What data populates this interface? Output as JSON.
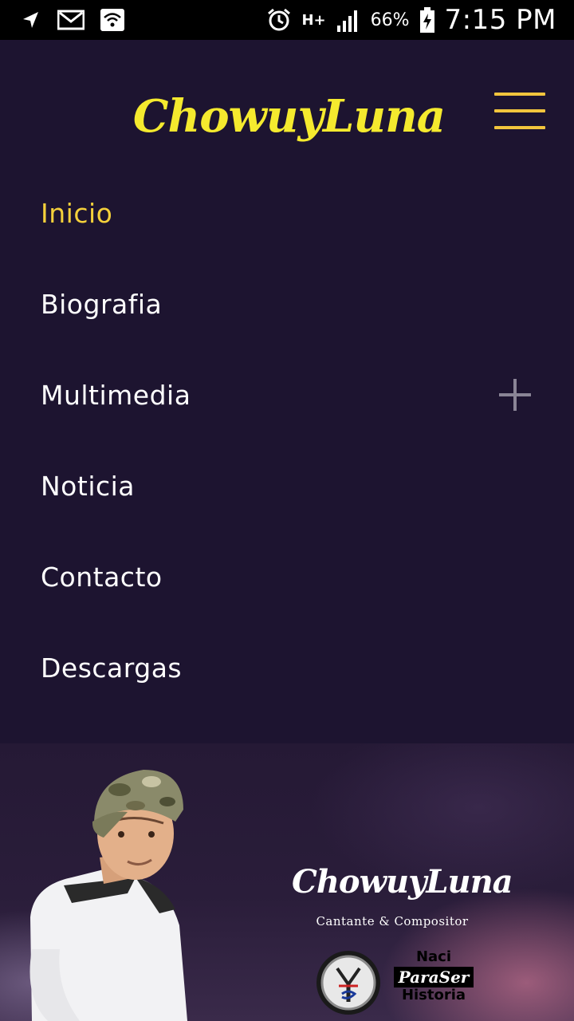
{
  "status_bar": {
    "icons_left": [
      "navigation-icon",
      "gmail-icon",
      "wifi-icon"
    ],
    "icons_right": [
      "alarm-icon",
      "hplus-data-icon",
      "signal-icon",
      "battery-charging-icon"
    ],
    "network": "H+",
    "battery_percent": "66%",
    "time": "7:15 PM"
  },
  "header": {
    "logo_text": "ChowuyLuna",
    "accent_color": "#f5ea2e",
    "hamburger_color": "#f2c53d"
  },
  "menu": {
    "items": [
      {
        "label": "Inicio",
        "active": true
      },
      {
        "label": "Biografia",
        "active": false
      },
      {
        "label": "Multimedia",
        "active": false,
        "expandable": true
      },
      {
        "label": "Noticia",
        "active": false
      },
      {
        "label": "Contacto",
        "active": false
      },
      {
        "label": "Descargas",
        "active": false
      }
    ],
    "active_color": "#f5d13b"
  },
  "banner": {
    "logo_text": "ChowuyLuna",
    "subtitle": "Cantante & Compositor",
    "badge_top": "Naci",
    "badge_middle": "ParaSer",
    "badge_bottom": "Historia"
  }
}
